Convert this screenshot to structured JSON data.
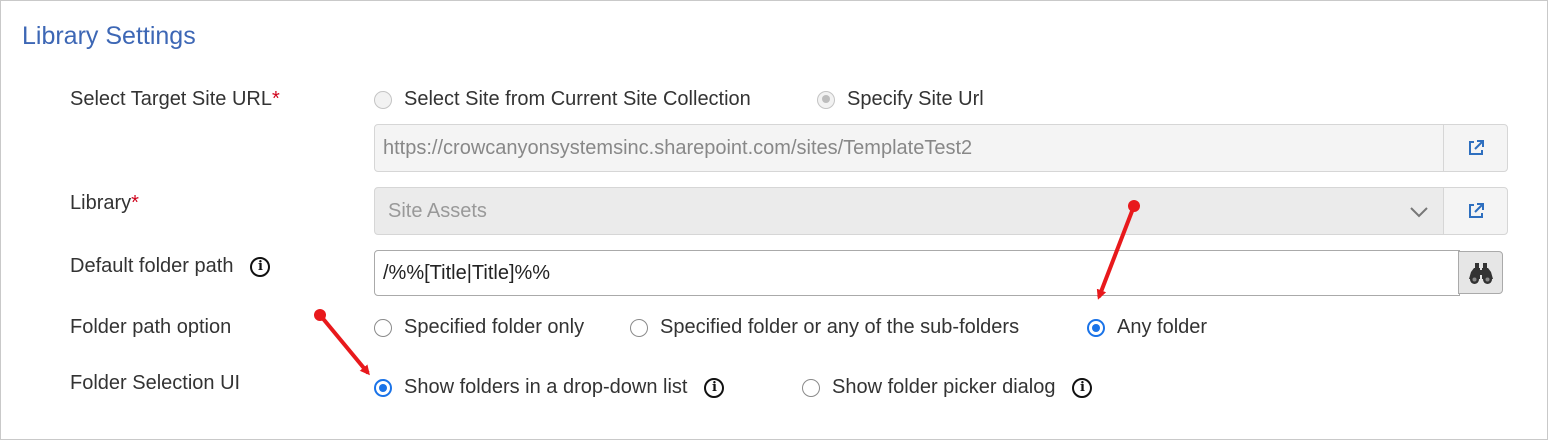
{
  "section_title": "Library Settings",
  "target_site": {
    "label": "Select Target Site URL",
    "required_mark": "*",
    "option_current": "Select Site from Current Site Collection",
    "option_specify": "Specify Site Url",
    "selected": "Specify Site Url",
    "url_value": "https://crowcanyonsystemsinc.sharepoint.com/sites/TemplateTest2",
    "open_icon": "external-link-icon"
  },
  "library": {
    "label": "Library",
    "required_mark": "*",
    "selected_value": "Site Assets",
    "open_icon": "external-link-icon"
  },
  "default_folder": {
    "label": "Default folder path",
    "value": "/%%[Title|Title]%%",
    "info_icon": "info-icon",
    "browse_icon": "binoculars-icon"
  },
  "folder_path_option": {
    "label": "Folder path option",
    "options": [
      "Specified folder only",
      "Specified folder or any of the sub-folders",
      "Any folder"
    ],
    "selected": "Any folder"
  },
  "folder_selection_ui": {
    "label": "Folder Selection UI",
    "options": [
      "Show folders in a drop-down list",
      "Show folder picker dialog"
    ],
    "selected": "Show folders in a drop-down list",
    "info_icon": "info-icon"
  },
  "annotation_color": "#e8191c",
  "accent_color": "#1a73e8",
  "title_color": "#3d67b5"
}
